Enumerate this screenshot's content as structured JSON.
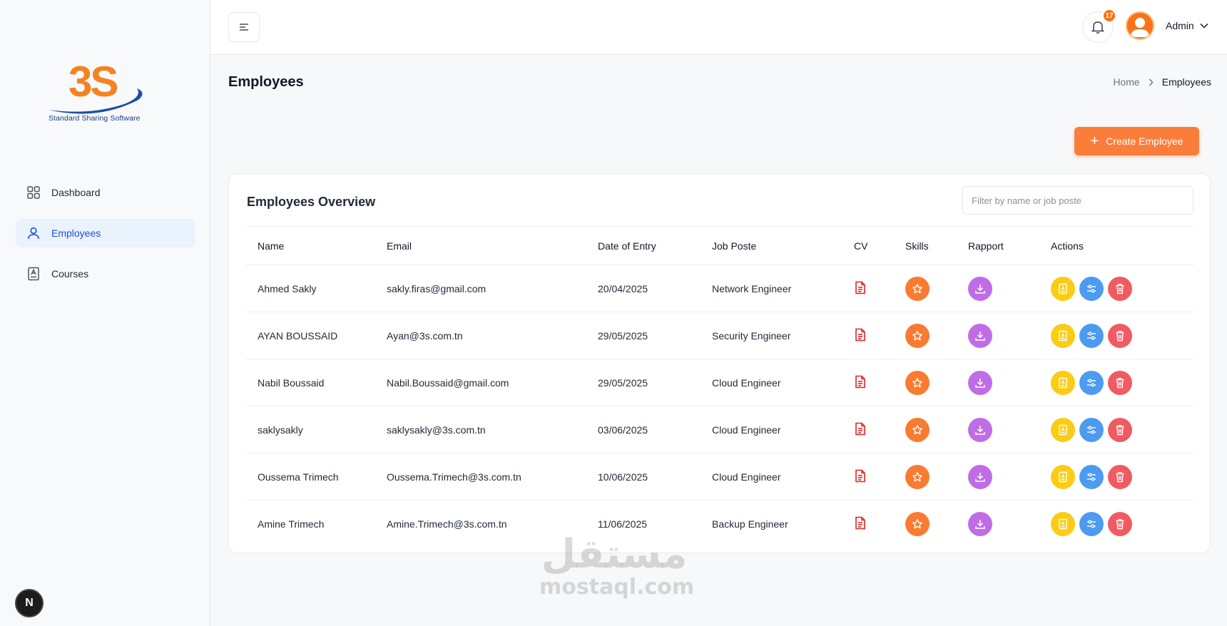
{
  "logo": {
    "text": "3S",
    "tagline": "Standard Sharing Software"
  },
  "sidebar": {
    "items": [
      {
        "label": "Dashboard",
        "icon": "grid-icon"
      },
      {
        "label": "Employees",
        "icon": "user-icon",
        "active": true
      },
      {
        "label": "Courses",
        "icon": "book-icon"
      }
    ],
    "bottom_badge": "N"
  },
  "topbar": {
    "notifications": "17",
    "user": "Admin"
  },
  "page": {
    "title": "Employees",
    "breadcrumb": [
      "Home",
      "Employees"
    ]
  },
  "create_button": "Create Employee",
  "card": {
    "title": "Employees Overview",
    "filter_placeholder": "Filter by name or job poste"
  },
  "table": {
    "headers": [
      "Name",
      "Email",
      "Date of Entry",
      "Job Poste",
      "CV",
      "Skills",
      "Rapport",
      "Actions"
    ],
    "rows": [
      {
        "name": "Ahmed Sakly",
        "email": "sakly.firas@gmail.com",
        "date": "20/04/2025",
        "job": "Network Engineer"
      },
      {
        "name": "AYAN BOUSSAID",
        "email": "Ayan@3s.com.tn",
        "date": "29/05/2025",
        "job": "Security Engineer"
      },
      {
        "name": "Nabil Boussaid",
        "email": "Nabil.Boussaid@gmail.com",
        "date": "29/05/2025",
        "job": "Cloud Engineer"
      },
      {
        "name": "saklysakly",
        "email": "saklysakly@3s.com.tn",
        "date": "03/06/2025",
        "job": "Cloud Engineer"
      },
      {
        "name": "Oussema Trimech",
        "email": "Oussema.Trimech@3s.com.tn",
        "date": "10/06/2025",
        "job": "Cloud Engineer"
      },
      {
        "name": "Amine Trimech",
        "email": "Amine.Trimech@3s.com.tn",
        "date": "11/06/2025",
        "job": "Backup Engineer"
      }
    ]
  },
  "watermark": {
    "arabic": "مستقل",
    "latin": "mostaql.com"
  },
  "colors": {
    "accent": "#fb7d3a",
    "skills": "#f97b32",
    "rapport": "#c06ce6",
    "edit": "#facc15",
    "assign": "#4d9bf0",
    "delete": "#f05b62",
    "cv": "#dc2626"
  }
}
